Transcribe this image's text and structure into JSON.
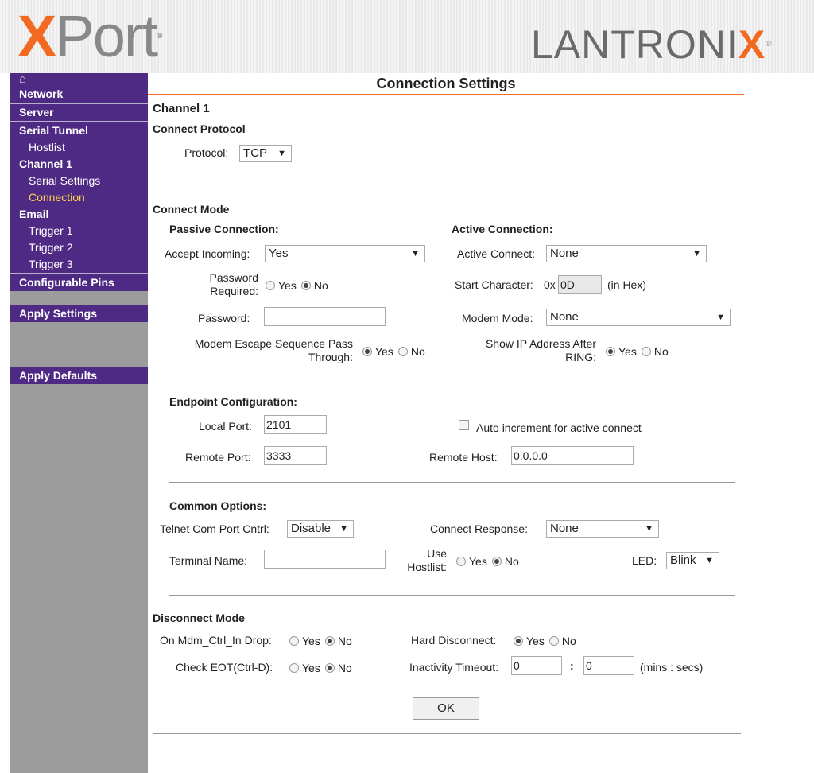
{
  "header": {
    "logo_left": {
      "x": "X",
      "rest": "Port",
      "mark": "®"
    },
    "logo_right": {
      "main": "LANTRONI",
      "x": "X",
      "mark": "®"
    }
  },
  "sidebar": {
    "home_icon": "home-icon",
    "items": [
      {
        "label": "Network"
      },
      {
        "label": "Server"
      },
      {
        "label": "Serial Tunnel"
      },
      {
        "label": "Hostlist"
      },
      {
        "label": "Channel 1"
      },
      {
        "label": "Serial Settings"
      },
      {
        "label": "Connection"
      },
      {
        "label": "Email"
      },
      {
        "label": "Trigger 1"
      },
      {
        "label": "Trigger 2"
      },
      {
        "label": "Trigger 3"
      },
      {
        "label": "Configurable Pins"
      },
      {
        "label": "Apply Settings"
      },
      {
        "label": "Apply Defaults"
      }
    ]
  },
  "page": {
    "title": "Connection Settings",
    "channel": "Channel 1"
  },
  "connect_protocol": {
    "heading": "Connect Protocol",
    "protocol_label": "Protocol:",
    "protocol_value": "TCP"
  },
  "connect_mode": {
    "heading": "Connect Mode",
    "passive": {
      "heading": "Passive Connection:",
      "accept_label": "Accept Incoming:",
      "accept_value": "Yes",
      "pwd_req_label_1": "Password",
      "pwd_req_label_2": "Required:",
      "pwd_req_yes": "Yes",
      "pwd_req_no": "No",
      "password_label": "Password:",
      "password_value": "",
      "escape_label_1": "Modem Escape Sequence Pass",
      "escape_label_2": "Through:",
      "escape_yes": "Yes",
      "escape_no": "No"
    },
    "active": {
      "heading": "Active Connection:",
      "connect_label": "Active Connect:",
      "connect_value": "None",
      "start_label": "Start Character:",
      "start_prefix": "0x",
      "start_value": "0D",
      "start_suffix": "(in Hex)",
      "modem_label": "Modem Mode:",
      "modem_value": "None",
      "showip_label_1": "Show IP Address After",
      "showip_label_2": "RING:",
      "showip_yes": "Yes",
      "showip_no": "No"
    }
  },
  "endpoint": {
    "heading": "Endpoint Configuration:",
    "local_label": "Local Port:",
    "local_value": "2101",
    "auto_label": "Auto increment for active connect",
    "remote_port_label": "Remote Port:",
    "remote_port_value": "3333",
    "remote_host_label": "Remote Host:",
    "remote_host_value": "0.0.0.0"
  },
  "common": {
    "heading": "Common Options:",
    "telnet_label": "Telnet Com Port Cntrl:",
    "telnet_value": "Disable",
    "response_label": "Connect Response:",
    "response_value": "None",
    "terminal_label": "Terminal Name:",
    "terminal_value": "",
    "hostlist_label_1": "Use",
    "hostlist_label_2": "Hostlist:",
    "hostlist_yes": "Yes",
    "hostlist_no": "No",
    "led_label": "LED:",
    "led_value": "Blink"
  },
  "disconnect": {
    "heading": "Disconnect Mode",
    "mdm_label": "On Mdm_Ctrl_In Drop:",
    "mdm_yes": "Yes",
    "mdm_no": "No",
    "hard_label": "Hard Disconnect:",
    "hard_yes": "Yes",
    "hard_no": "No",
    "eot_label": "Check EOT(Ctrl-D):",
    "eot_yes": "Yes",
    "eot_no": "No",
    "inact_label": "Inactivity Timeout:",
    "inact_min": "0",
    "inact_sep": ":",
    "inact_sec": "0",
    "inact_units": "(mins : secs)"
  },
  "ok_button": "OK",
  "colors": {
    "accent": "#f26a21",
    "sidebar": "#4e2a84",
    "sidebar_active": "#ffd24d"
  }
}
